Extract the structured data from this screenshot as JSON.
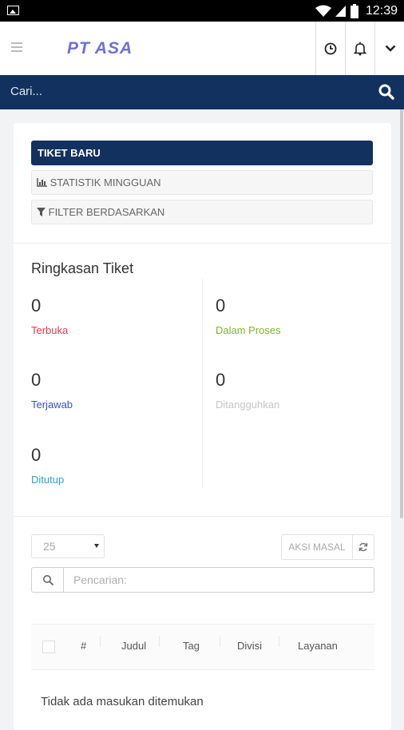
{
  "status_bar": {
    "time": "12:39"
  },
  "app": {
    "brand": "PT ASA"
  },
  "search": {
    "placeholder": "Cari..."
  },
  "buttons": {
    "new_ticket": "TIKET BARU",
    "weekly_stats": "STATISTIK MINGGUAN",
    "filter_by": "FILTER BERDASARKAN"
  },
  "summary": {
    "title": "Ringkasan Tiket",
    "stats": [
      {
        "value": "0",
        "label": "Terbuka",
        "color": "#e8384f"
      },
      {
        "value": "0",
        "label": "Dalam Proses",
        "color": "#7ab82b"
      },
      {
        "value": "0",
        "label": "Terjawab",
        "color": "#3b4fd6"
      },
      {
        "value": "0",
        "label": "Ditangguhkan",
        "color": "#c6c6c6"
      },
      {
        "value": "0",
        "label": "Ditutup",
        "color": "#2aa2d6"
      }
    ]
  },
  "table": {
    "page_size": "25",
    "bulk_action": "AKSI MASAL",
    "search_placeholder": "Pencarian:",
    "columns": [
      "#",
      "Judul",
      "Tag",
      "Divisi",
      "Layanan"
    ],
    "empty_message": "Tidak ada masukan ditemukan"
  },
  "colors": {
    "navy": "#13315f",
    "brand": "#6f6fd8"
  }
}
